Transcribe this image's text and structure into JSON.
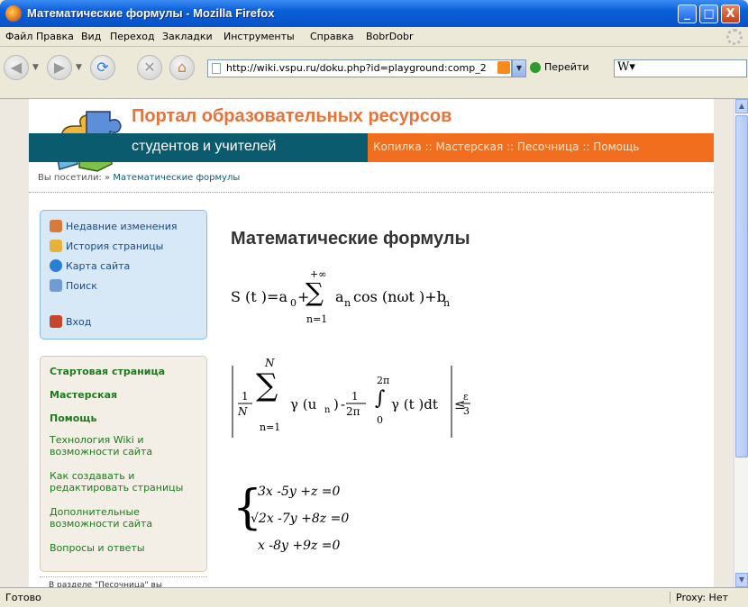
{
  "window": {
    "title": "Математические формулы - Mozilla Firefox",
    "minimize": "_",
    "maximize": "□",
    "close": "X"
  },
  "menu": [
    "Файл",
    "Правка",
    "Вид",
    "Переход",
    "Закладки",
    "Инструменты",
    "Справка",
    "BobrDobr"
  ],
  "navbar": {
    "url": "http://wiki.vspu.ru/doku.php?id=playground:comp_2",
    "go_label": "Перейти",
    "search_value": "W"
  },
  "site": {
    "title": "Портал образовательных ресурсов",
    "subtitle": "студентов и учителей",
    "topnav": "Копилка :: Мастерская :: Песочница :: Помощь",
    "breadcrumb_prefix": "Вы посетили: »",
    "breadcrumb_link": "Математические формулы"
  },
  "tools": [
    {
      "label": "Недавние изменения",
      "icon": "recent-changes-icon",
      "color": "#d97a3a"
    },
    {
      "label": "История страницы",
      "icon": "history-icon",
      "color": "#e6b23c"
    },
    {
      "label": "Карта сайта",
      "icon": "sitemap-icon",
      "color": "#2a7fd4"
    },
    {
      "label": "Поиск",
      "icon": "search-icon",
      "color": "#6f9dd3"
    },
    {
      "label": "Вход",
      "icon": "login-icon",
      "color": "#c8442a"
    }
  ],
  "sidenav": [
    {
      "label": "Стартовая страница",
      "bold": true
    },
    {
      "label": "Мастерская",
      "bold": true
    },
    {
      "label": "Помощь",
      "bold": true
    },
    {
      "label": "Технология Wiki и возможности сайта",
      "bold": false
    },
    {
      "label": "Как создавать и редактировать страницы",
      "bold": false
    },
    {
      "label": "Дополнительные возможности сайта",
      "bold": false
    },
    {
      "label": "Вопросы и ответы",
      "bold": false
    }
  ],
  "bottom_text": "В разделе \"Песочница\" вы",
  "page_heading": "Математические формулы",
  "formulas": {
    "f1_lhs": "S (t )=a",
    "f1_sub0": "0",
    "f1_plus": "+",
    "f1_sum_top": "+∞",
    "f1_sum_bottom": "n=1",
    "f1_an": "a",
    "f1_an_sub": "n",
    "f1_cos": "cos (nωt )+b",
    "f1_bn_sub": "n",
    "f2_frac1_num": "1",
    "f2_frac1_den": "N",
    "f2_sum_top": "N",
    "f2_sum_bottom": "n=1",
    "f2_gamma": "γ (u",
    "f2_u_sub": "n",
    "f2_close": ")",
    "f2_minus": "-",
    "f2_frac2_num": "1",
    "f2_frac2_den": "2π",
    "f2_int_top": "2π",
    "f2_int_bottom": "0",
    "f2_integrand": "γ (t )dt",
    "f2_le": "≤",
    "f2_eps_num": "ε",
    "f2_eps_den": "3",
    "sys_line1": "3x -5y +z =0",
    "sys_line2": "√2x -7y +8z =0",
    "sys_line3": "x -8y +9z =0"
  },
  "status": {
    "left": "Готово",
    "right": "Proxy: Нет"
  }
}
